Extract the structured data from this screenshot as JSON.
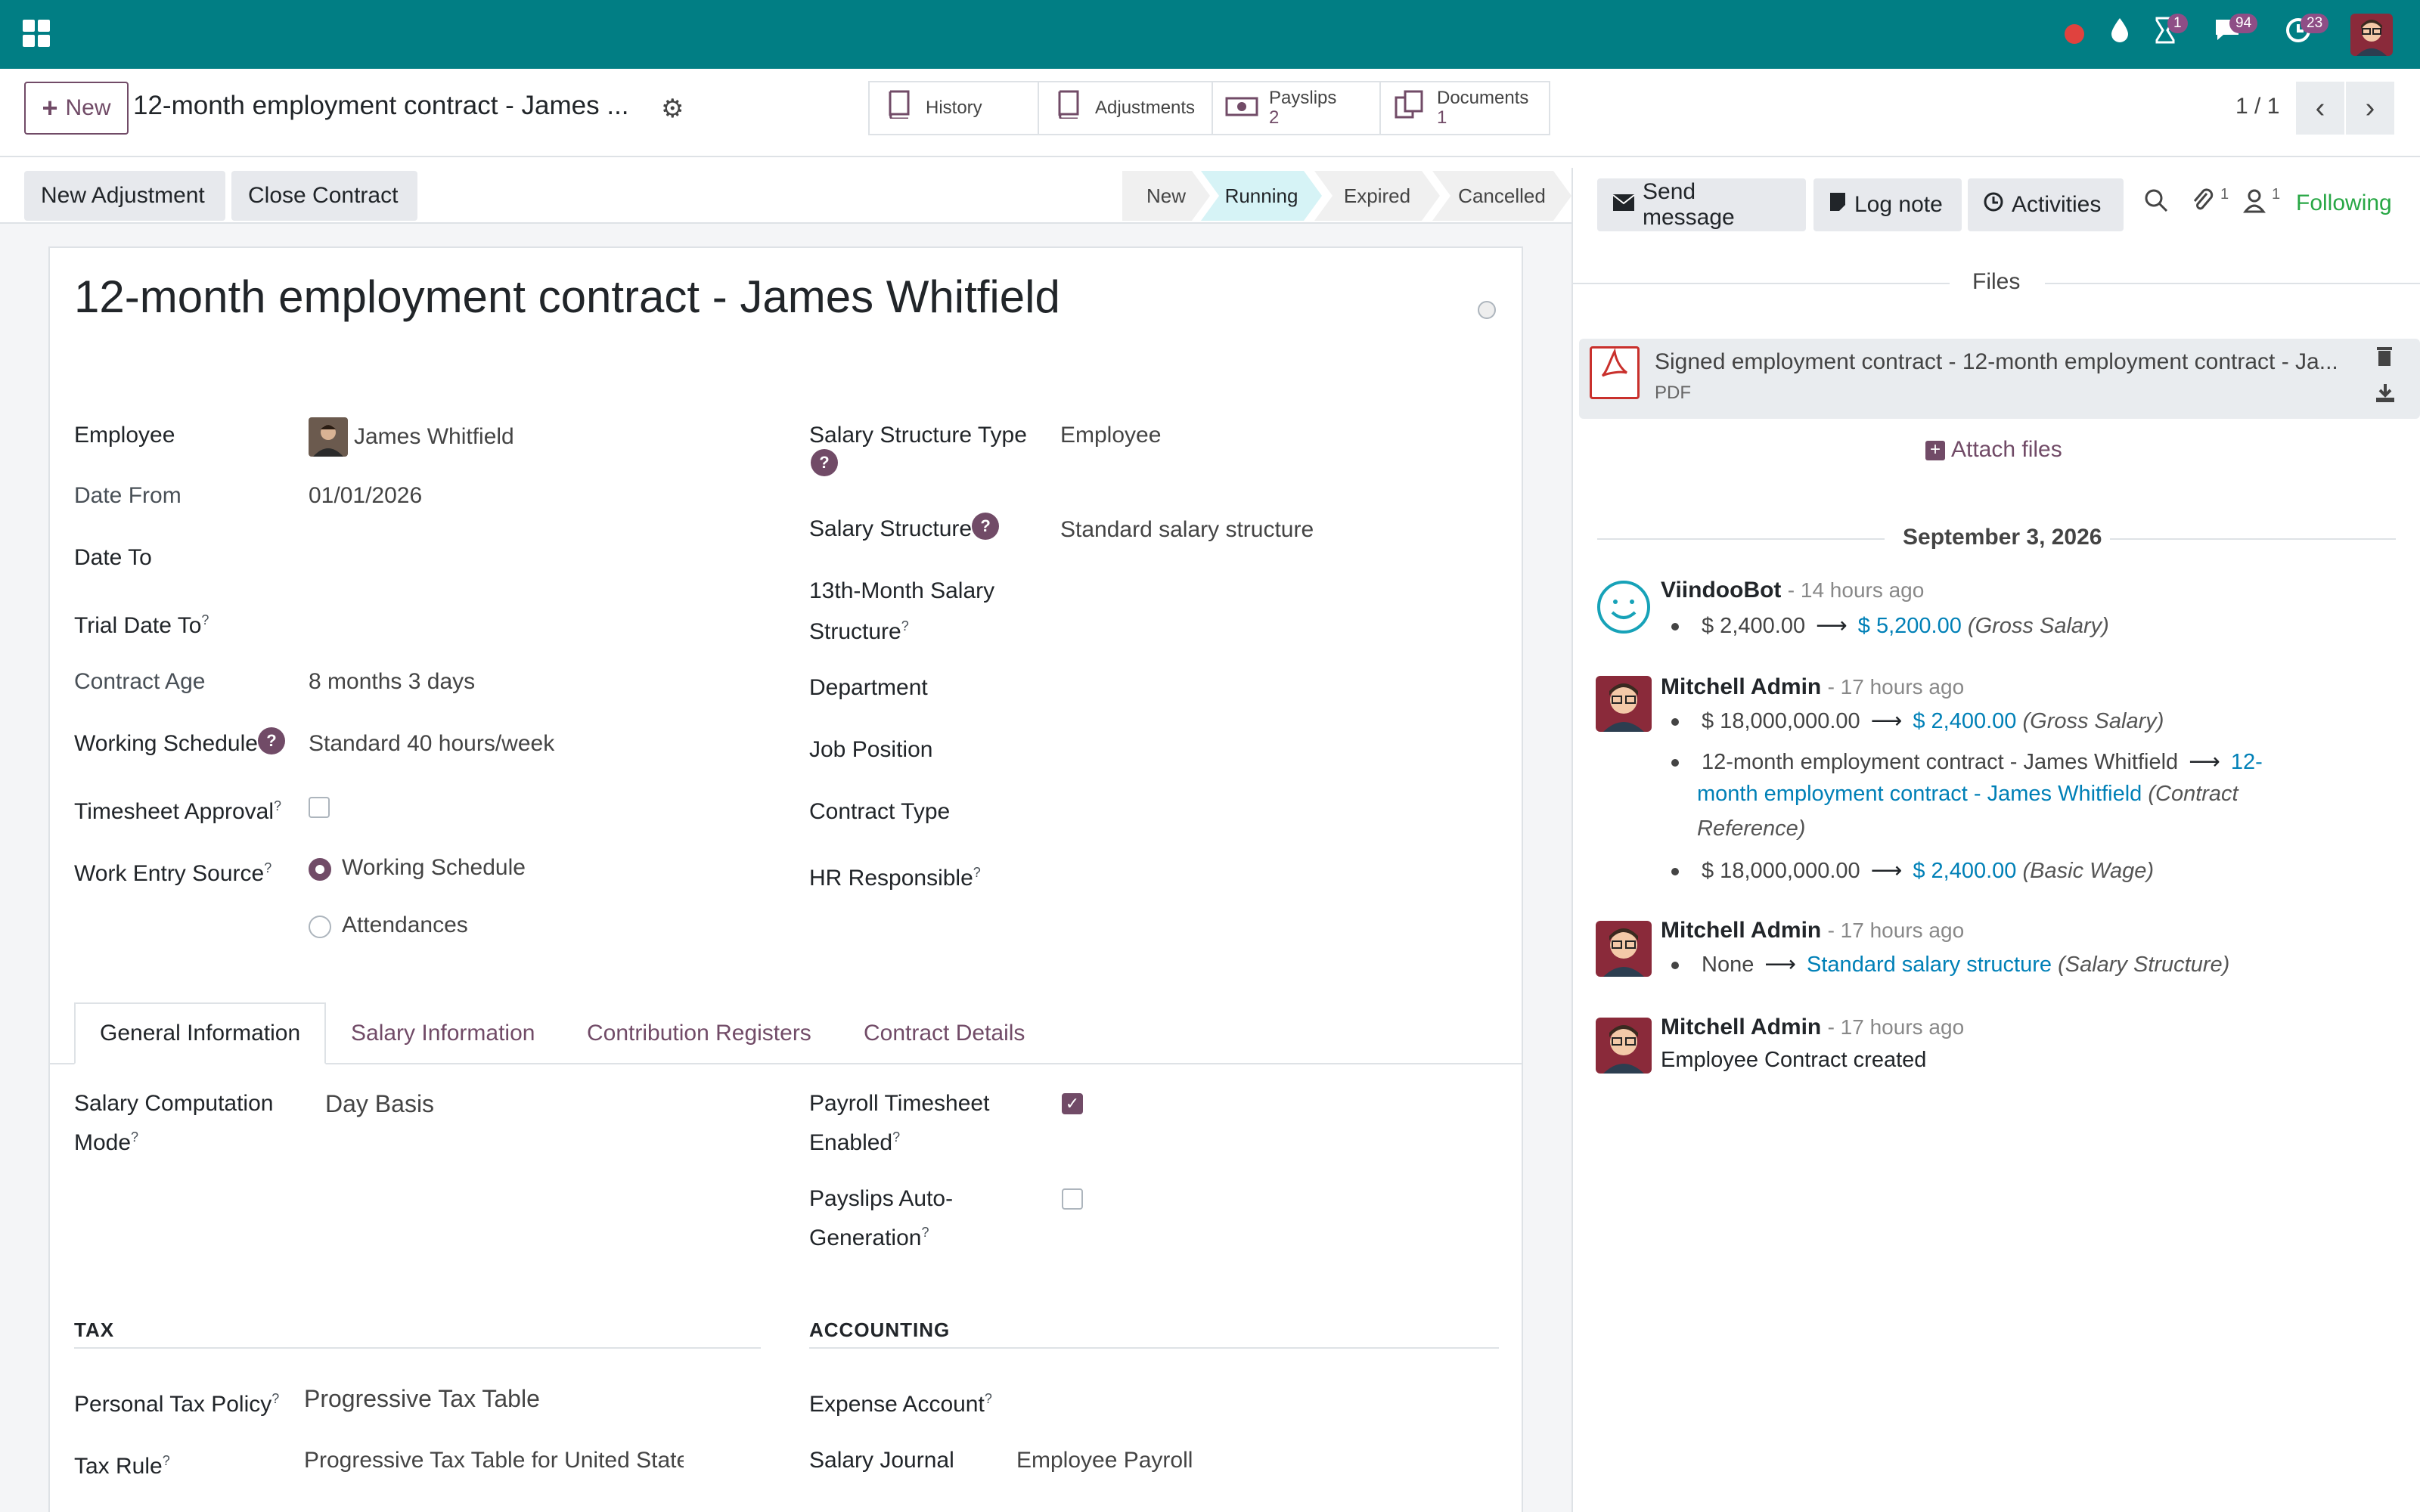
{
  "topbar": {
    "badges": {
      "activity": "1",
      "messages": "94",
      "clock": "23"
    }
  },
  "control": {
    "new_label": "New",
    "record_title": "12-month employment contract - James ...",
    "smart_buttons": [
      {
        "label": "History",
        "count": ""
      },
      {
        "label": "Adjustments",
        "count": ""
      },
      {
        "label": "Payslips",
        "count": "2"
      },
      {
        "label": "Documents",
        "count": "1"
      }
    ],
    "pager": "1 / 1"
  },
  "statusbar": {
    "actions": [
      "New Adjustment",
      "Close Contract"
    ],
    "stages": [
      "New",
      "Running",
      "Expired",
      "Cancelled"
    ],
    "active_stage": "Running"
  },
  "form": {
    "title": "12-month employment contract - James Whitfield",
    "left": {
      "employee": {
        "label": "Employee",
        "value": "James Whitfield"
      },
      "date_from": {
        "label": "Date From",
        "value": "01/01/2026"
      },
      "date_to": {
        "label": "Date To",
        "value": ""
      },
      "trial_date_to": {
        "label": "Trial Date To",
        "value": ""
      },
      "contract_age": {
        "label": "Contract Age",
        "value": "8 months 3 days"
      },
      "working_schedule": {
        "label": "Working Schedule",
        "value": "Standard 40 hours/week"
      },
      "timesheet_approval": {
        "label": "Timesheet Approval",
        "checked": false
      },
      "work_entry_source": {
        "label": "Work Entry Source",
        "options": [
          "Working Schedule",
          "Attendances"
        ],
        "selected": "Working Schedule"
      }
    },
    "right": {
      "salary_structure_type": {
        "label": "Salary Structure Type",
        "value": "Employee"
      },
      "salary_structure": {
        "label": "Salary Structure",
        "value": "Standard salary structure"
      },
      "thirteenth_month_l1": "13th-Month Salary",
      "thirteenth_month_l2": "Structure",
      "department": {
        "label": "Department",
        "value": ""
      },
      "job_position": {
        "label": "Job Position",
        "value": ""
      },
      "contract_type": {
        "label": "Contract Type",
        "value": ""
      },
      "hr_responsible": {
        "label": "HR Responsible",
        "value": ""
      }
    },
    "tabs": [
      "General Information",
      "Salary Information",
      "Contribution Registers",
      "Contract Details"
    ],
    "active_tab": "General Information",
    "general": {
      "salary_computation_l1": "Salary Computation",
      "salary_computation_l2": "Mode",
      "salary_computation_value": "Day Basis",
      "payroll_timesheet_l1": "Payroll Timesheet",
      "payroll_timesheet_l2": "Enabled",
      "payroll_timesheet_checked": true,
      "payslips_auto_l1": "Payslips Auto-",
      "payslips_auto_l2": "Generation",
      "payslips_auto_checked": false,
      "tax_section": "TAX",
      "accounting_section": "ACCOUNTING",
      "personal_tax_policy": {
        "label": "Personal Tax Policy",
        "value": "Progressive Tax Table"
      },
      "tax_rule": {
        "label": "Tax Rule",
        "value": "Progressive Tax Table for United State"
      },
      "expense_account": {
        "label": "Expense Account",
        "value": ""
      },
      "salary_journal": {
        "label": "Salary Journal",
        "value": "Employee Payroll"
      }
    }
  },
  "chatter": {
    "send_message": "Send message",
    "log_note": "Log note",
    "activities": "Activities",
    "attachment_count": "1",
    "follower_count": "1",
    "following": "Following",
    "files_header": "Files",
    "attachment": {
      "name": "Signed employment contract - 12-month employment contract - Ja...",
      "type": "PDF"
    },
    "attach_files": "Attach files",
    "date_separator": "September 3, 2026",
    "messages": [
      {
        "author": "ViindooBot",
        "time": "- 14 hours ago",
        "changes": [
          {
            "old": "$ 2,400.00",
            "new": "$ 5,200.00",
            "field": "(Gross Salary)"
          }
        ]
      },
      {
        "author": "Mitchell Admin",
        "time": "- 17 hours ago",
        "changes": [
          {
            "old": "$ 18,000,000.00",
            "new": "$ 2,400.00",
            "field": "(Gross Salary)"
          },
          {
            "old": "12-month employment contract - James Whitfield",
            "new_l1": "12-",
            "new_l2": "month employment contract - James Whitfield",
            "field_l1": "(Contract",
            "field_l2": "Reference)"
          },
          {
            "old": "$ 18,000,000.00",
            "new": "$ 2,400.00",
            "field": "(Basic Wage)"
          }
        ]
      },
      {
        "author": "Mitchell Admin",
        "time": "- 17 hours ago",
        "changes": [
          {
            "old": "None",
            "new": "Standard salary structure",
            "field": "(Salary Structure)"
          }
        ]
      },
      {
        "author": "Mitchell Admin",
        "time": "- 17 hours ago",
        "body": "Employee Contract created"
      }
    ]
  }
}
